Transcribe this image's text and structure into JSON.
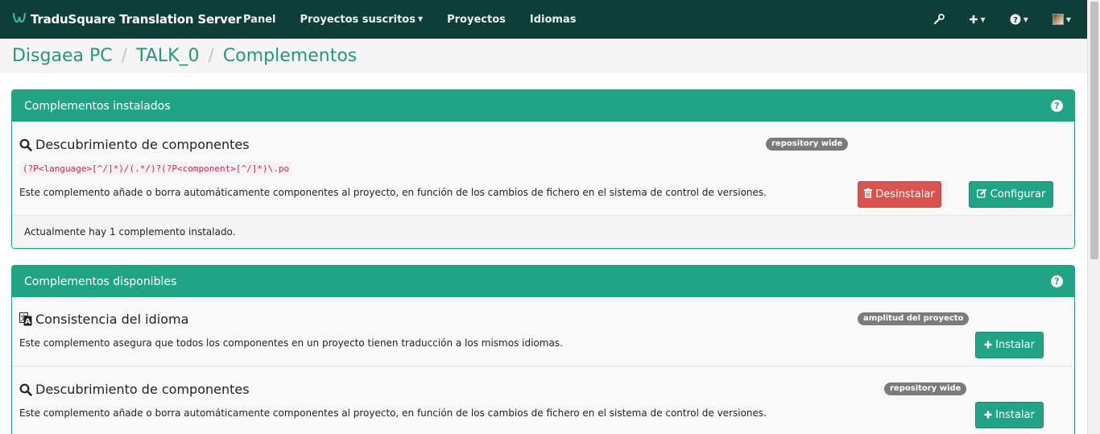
{
  "navbar": {
    "brand_icon": "W",
    "brand_name": "TraduSquare Translation Server",
    "links": [
      {
        "label": "Panel",
        "dropdown": false
      },
      {
        "label": "Proyectos suscritos",
        "dropdown": true
      },
      {
        "label": "Proyectos",
        "dropdown": false
      },
      {
        "label": "Idiomas",
        "dropdown": false
      }
    ],
    "right_icons": [
      "wrench-icon",
      "plus-icon",
      "help-icon",
      "avatar-icon"
    ]
  },
  "breadcrumb": [
    "Disgaea PC",
    "TALK_0",
    "Complementos"
  ],
  "installed": {
    "heading": "Complementos instalados",
    "item": {
      "title": "Descubrimiento de componentes",
      "badge": "repository wide",
      "regex": "(?P<language>[^/]*)/(.*/)?(?P<component>[^/]*)\\.po",
      "description": "Este complemento añade o borra automáticamente componentes al proyecto, en función de los cambios de fichero en el sistema de control de versiones.",
      "uninstall_label": "Desinstalar",
      "configure_label": "Configurar"
    },
    "footer": "Actualmente hay 1 complemento instalado."
  },
  "available": {
    "heading": "Complementos disponibles",
    "items": [
      {
        "title": "Consistencia del idioma",
        "badge": "amplitud del proyecto",
        "description": "Este complemento asegura que todos los componentes en un proyecto tienen traducción a los mismos idiomas.",
        "install_label": "Instalar",
        "icon": "language-icon"
      },
      {
        "title": "Descubrimiento de componentes",
        "badge": "repository wide",
        "description": "Este complemento añade o borra automáticamente componentes al proyecto, en función de los cambios de fichero en el sistema de control de versiones.",
        "install_label": "Instalar",
        "icon": "search-icon"
      }
    ]
  },
  "colors": {
    "navbar": "#0f3d37",
    "accent": "#21a386",
    "danger": "#d9534f"
  }
}
